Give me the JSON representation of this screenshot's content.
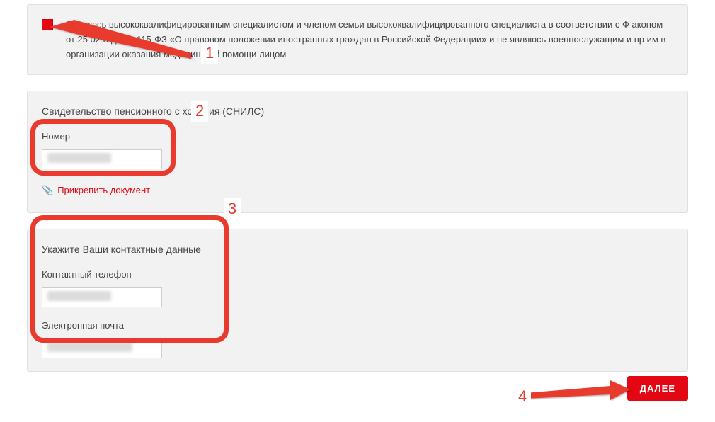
{
  "declaration": {
    "text": "Я         вляюсь высококвалифицированным специалистом и членом семьи высококвалифицированного специалиста в соответствии с Ф                        аконом от 25             02 года № 115-ФЗ «О правовом положении иностранных граждан в Российской Федерации»  и не являюсь военнослужащим и пр                           им в организации оказания медицинской помощи лицом"
  },
  "snils": {
    "title": "Свидетельство пенсионного с     хования (СНИЛС)",
    "number_label": "Номер",
    "number_value": "",
    "attach_label": "Прикрепить документ"
  },
  "contacts": {
    "title": "Укажите Ваши контактные данные",
    "phone_label": "Контактный телефон",
    "phone_value": "",
    "email_label": "Электронная почта",
    "email_value": ""
  },
  "actions": {
    "next_label": "ДАЛЕЕ"
  },
  "annotations": {
    "n1": "1",
    "n2": "2",
    "n3": "3",
    "n4": "4"
  },
  "colors": {
    "accent": "#e30613",
    "highlight": "#e83a2d",
    "panel_bg": "#f2f2f2"
  }
}
